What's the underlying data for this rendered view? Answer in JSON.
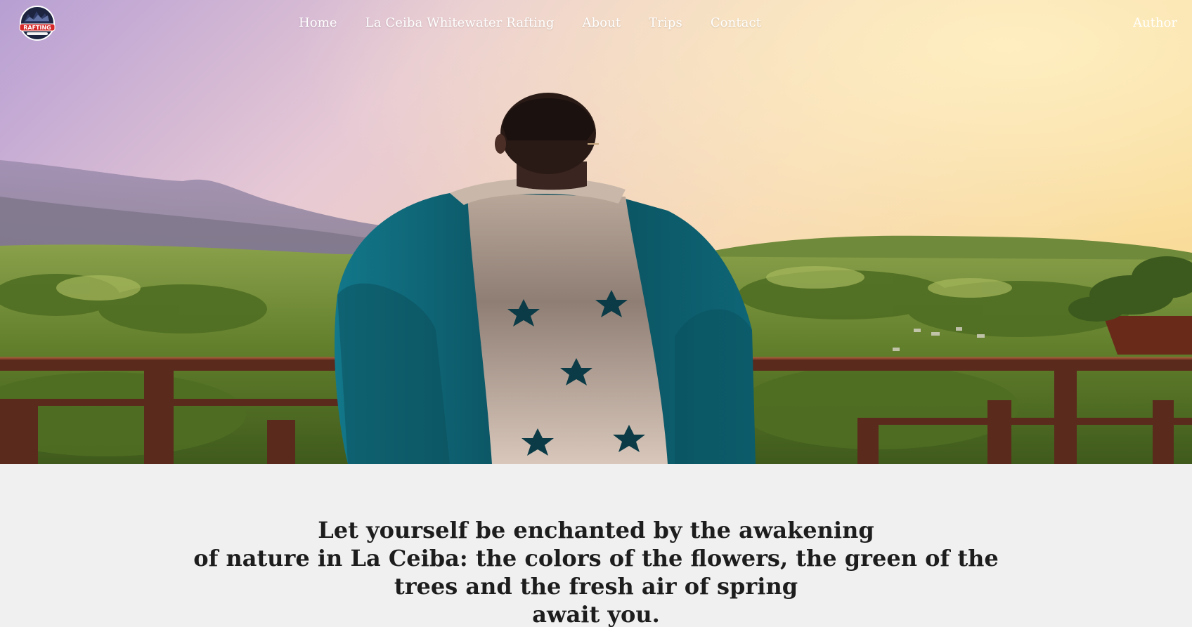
{
  "nav": {
    "logo": {
      "text": "RAFTING",
      "icon": "rafting-logo"
    },
    "links": [
      "Home",
      "La Ceiba Whitewater Rafting",
      "About",
      "Trips",
      "Contact"
    ],
    "author": "Author"
  },
  "hero": {
    "image_subject": "man-with-honduras-flag-overlooking-forest",
    "colors": {
      "sky_top": "#b79fd3",
      "sky_glow": "#f5d49b",
      "flag_blue": "#0f6d80",
      "flag_white": "#f3ede6"
    }
  },
  "intro": {
    "lines": [
      "Let yourself be enchanted by the awakening",
      "of nature in La Ceiba: the colors of the flowers, the green of the",
      "trees and the fresh air of spring",
      "await you."
    ]
  }
}
